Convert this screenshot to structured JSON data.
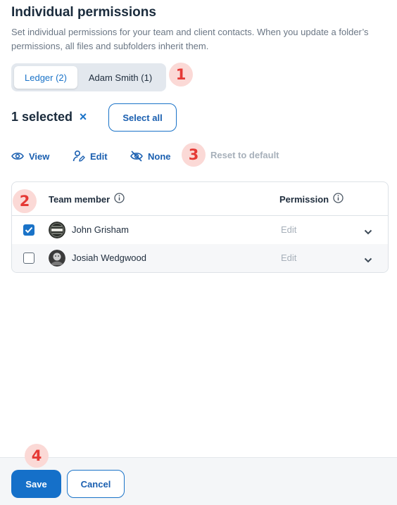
{
  "header": {
    "title": "Individual permissions",
    "subtitle": "Set individual permissions for your team and client contacts. When you update a folder’s permissions, all files and subfolders inherit them."
  },
  "tabs": [
    {
      "label": "Ledger (2)",
      "active": true
    },
    {
      "label": "Adam Smith (1)",
      "active": false
    }
  ],
  "markers": [
    "1",
    "2",
    "3",
    "4"
  ],
  "selection": {
    "label": "1 selected",
    "clear_icon": "×",
    "select_all_label": "Select all"
  },
  "actions": {
    "view_label": "View",
    "edit_label": "Edit",
    "none_label": "None",
    "reset_label": "Reset to default"
  },
  "table": {
    "columns": [
      "Team member",
      "Permission"
    ],
    "rows": [
      {
        "name": "John Grisham",
        "permission": "Edit",
        "checked": true,
        "avatar": "ledger-logo-avatar"
      },
      {
        "name": "Josiah Wedgwood",
        "permission": "Edit",
        "checked": false,
        "avatar": "portrait-avatar"
      }
    ]
  },
  "footer": {
    "save_label": "Save",
    "cancel_label": "Cancel"
  },
  "colors": {
    "accent": "#1a73c8",
    "marker_bg": "#fbd9d6",
    "marker_text": "#e53935",
    "disabled_text": "#a7b0ba"
  }
}
